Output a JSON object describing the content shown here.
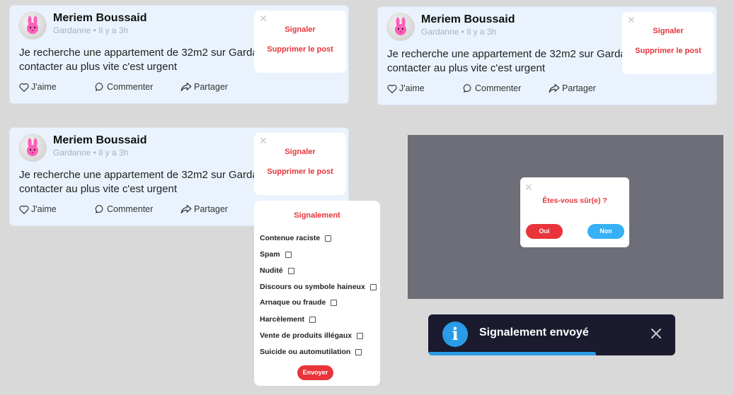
{
  "post": {
    "author": "Meriem Boussaid",
    "meta": "Gardanne • Il y a 3h",
    "line1": "Je recherche une appartement de 32m2 sur Gardanne",
    "line2": "contacter au plus vite c'est urgent",
    "like_label": "J'aime",
    "comment_label": "Commenter",
    "share_label": "Partager"
  },
  "post_menu": {
    "close_glyph": "✕",
    "report_label": "Signaler",
    "delete_label": "Supprimer le post"
  },
  "report_panel": {
    "title": "Signalement",
    "items": [
      "Contenue raciste",
      "Spam",
      "Nudité",
      "Discours ou symbole haineux",
      "Arnaque ou fraude",
      "Harcèlement",
      "Vente de produits illégaux",
      "Suicide ou automutilation"
    ],
    "send_label": "Envoyer"
  },
  "confirm_dialog": {
    "close_glyph": "✕",
    "question": "Êtes-vous sûr(e) ?",
    "yes_label": "Oui",
    "no_label": "Non"
  },
  "toast": {
    "icon_glyph": "i",
    "message": "Signalement envoyé",
    "progress": 0.68
  },
  "colors": {
    "accent_red": "#e8343a",
    "accent_blue": "#2a9be6",
    "post_bg": "#eaf3fd",
    "toast_bg": "#1a1b2e",
    "overlay": "#6e6e78"
  },
  "icons": [
    "avatar-bunny-icon",
    "heart-icon",
    "comment-icon",
    "share-icon",
    "close-icon",
    "info-icon"
  ]
}
